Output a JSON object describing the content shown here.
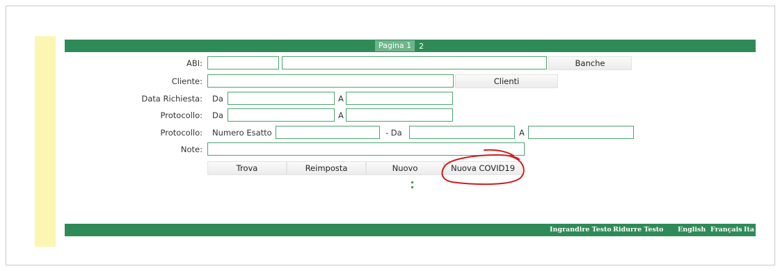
{
  "pager": {
    "current": "Pagina 1",
    "next": "2"
  },
  "form": {
    "abi_label": "ABI:",
    "abi_code_value": "",
    "abi_name_value": "",
    "banche_button": "Banche",
    "cliente_label": "Cliente:",
    "cliente_value": "",
    "clienti_button": "Clienti",
    "data_richiesta_label": "Data Richiesta:",
    "data_da": "Da",
    "data_a": "A",
    "data_da_value": "",
    "data_a_value": "",
    "protocollo_label": "Protocollo:",
    "protocollo_da": "Da",
    "protocollo_a": "A",
    "protocollo2_label": "Protocollo:",
    "numero_esatto": "Numero Esatto",
    "range_dash_da": "- Da",
    "range_a": "A",
    "note_label": "Note:",
    "note_value": ""
  },
  "actions": {
    "trova": "Trova",
    "reimposta": "Reimposta",
    "nuovo": "Nuovo",
    "nuova_covid": "Nuova COVID19"
  },
  "footer": {
    "ingrandire": "Ingrandire Testo",
    "ridurre": "Ridurre Testo",
    "english": "English",
    "francais": "Français",
    "italiano_partial": "Ita"
  },
  "colors": {
    "bar_green": "#2e8b57",
    "input_border": "#4ca36f",
    "sidebar_yellow": "#fbf6b2",
    "annotation_red": "#d11a1a"
  }
}
